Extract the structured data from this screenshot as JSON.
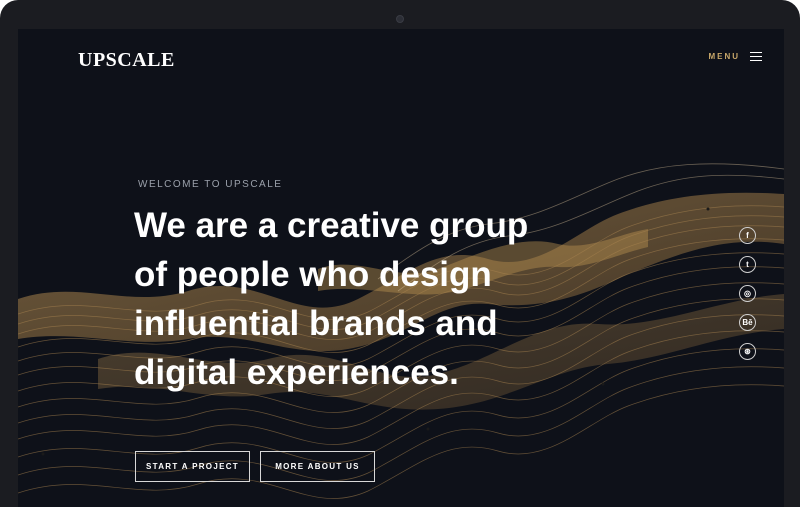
{
  "brand": {
    "logo": "UPSCALE"
  },
  "nav": {
    "menu_label": "MENU"
  },
  "hero": {
    "eyebrow": "WELCOME TO UPSCALE",
    "headline_lines": [
      "We are a creative group",
      "of people who design",
      "influential brands and",
      "digital experiences."
    ]
  },
  "buttons": {
    "start_label": "START A PROJECT",
    "more_label": "MORE ABOUT US"
  },
  "social": [
    {
      "icon": "facebook-icon",
      "glyph": "f"
    },
    {
      "icon": "twitter-icon",
      "glyph": "t"
    },
    {
      "icon": "instagram-icon",
      "glyph": "◎"
    },
    {
      "icon": "behance-icon",
      "glyph": "Bē"
    },
    {
      "icon": "dribbble-icon",
      "glyph": "⊛"
    }
  ],
  "colors": {
    "screen_bg": "#0e1119",
    "accent_gold": "#c9a86a",
    "wave_gold": "#9c7a45",
    "text_white": "#ffffff"
  }
}
